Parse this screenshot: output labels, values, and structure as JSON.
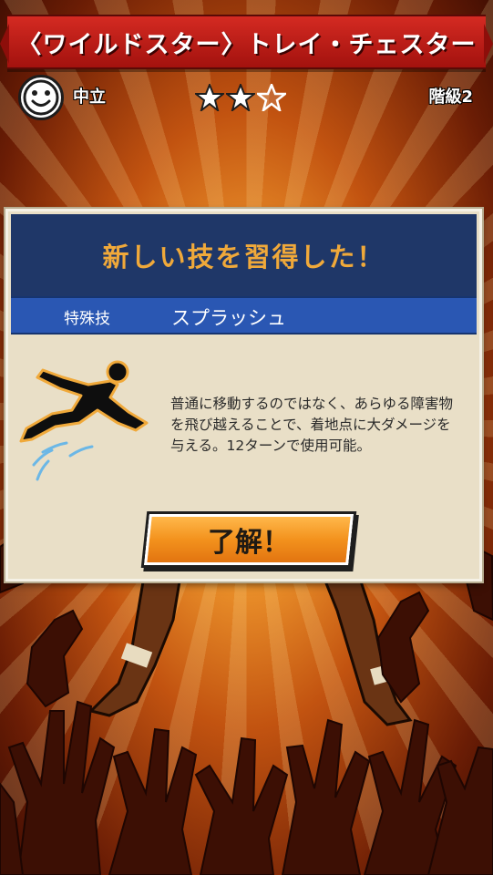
{
  "header": {
    "title": "〈ワイルドスター〉トレイ・チェスター"
  },
  "status": {
    "alignment": "中立",
    "stars_filled": 2,
    "stars_total": 3,
    "rank_label": "階級",
    "rank_value": "2"
  },
  "dialog": {
    "title": "新しい技を習得した！",
    "skill_type": "特殊技",
    "skill_name": "スプラッシュ",
    "description": "普通に移動するのではなく、あらゆる障害物を飛び越えることで、着地点に大ダメージを与える。12ターンで使用可能。",
    "ok_label": "了解！"
  },
  "icons": {
    "avatar": "smiley-face-icon",
    "star": "star-icon",
    "skill": "leaping-figure-icon"
  },
  "colors": {
    "banner": "#c41e18",
    "dialog_header": "#1f3768",
    "dialog_title": "#f0a93a",
    "skill_bar": "#2a57b3",
    "button": "#f3921d"
  }
}
